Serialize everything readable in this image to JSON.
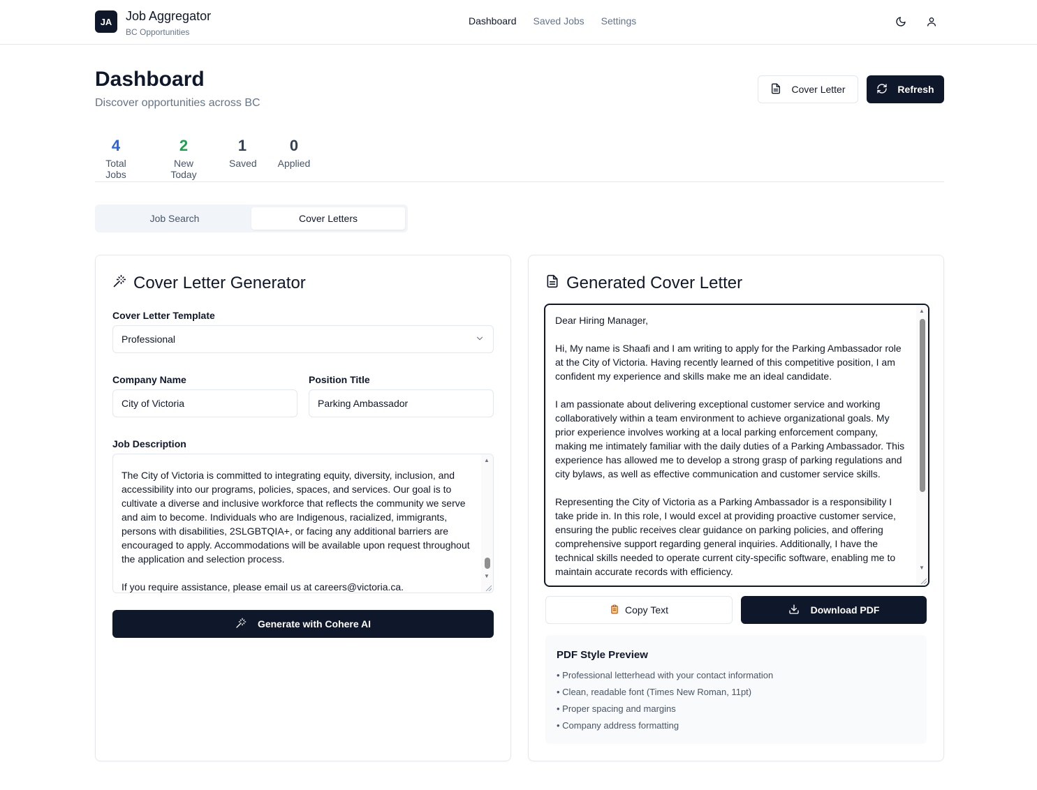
{
  "header": {
    "logo_text": "JA",
    "app_title": "Job Aggregator",
    "app_subtitle": "BC Opportunities",
    "nav": [
      {
        "label": "Dashboard",
        "active": true
      },
      {
        "label": "Saved Jobs",
        "active": false
      },
      {
        "label": "Settings",
        "active": false
      }
    ],
    "icons": [
      "moon-icon",
      "user-icon"
    ]
  },
  "page": {
    "title": "Dashboard",
    "subtitle": "Discover opportunities across BC",
    "cover_letter_button": "Cover Letter",
    "refresh_button": "Refresh"
  },
  "stats": [
    {
      "value": "4",
      "label": "Total Jobs",
      "color": "#2563eb"
    },
    {
      "value": "2",
      "label": "New Today",
      "color": "#16a34a"
    },
    {
      "value": "1",
      "label": "Saved",
      "color": "#334155"
    },
    {
      "value": "0",
      "label": "Applied",
      "color": "#334155"
    }
  ],
  "tabs": [
    {
      "label": "Job Search",
      "active": false
    },
    {
      "label": "Cover Letters",
      "active": true
    }
  ],
  "generator": {
    "title": "Cover Letter Generator",
    "template_label": "Cover Letter Template",
    "template_value": "Professional",
    "company_label": "Company Name",
    "company_value": "City of Victoria",
    "position_label": "Position Title",
    "position_value": "Parking Ambassador",
    "description_label": "Job Description",
    "description_value": "The City of Victoria is committed to integrating equity, diversity, inclusion, and accessibility into our programs, policies, spaces, and services. Our goal is to cultivate a diverse and inclusive workforce that reflects the community we serve and aim to become. Individuals who are Indigenous, racialized, immigrants, persons with disabilities, 2SLGBTQIA+, or facing any additional barriers are encouraged to apply. Accommodations will be available upon request throughout the application and selection process.\n\nIf you require assistance, please email us at careers@victoria.ca.",
    "generate_button": "Generate with Cohere AI"
  },
  "output": {
    "title": "Generated Cover Letter",
    "letter_text": "Dear Hiring Manager,\n\nHi, My name is Shaafi and I am writing to apply for the Parking Ambassador role at the City of Victoria. Having recently learned of this competitive position, I am confident my experience and skills make me an ideal candidate.\n\nI am passionate about delivering exceptional customer service and working collaboratively within a team environment to achieve organizational goals. My prior experience involves working at a local parking enforcement company, making me intimately familiar with the daily duties of a Parking Ambassador. This experience has allowed me to develop a strong grasp of parking regulations and city bylaws, as well as effective communication and customer service skills.\n\nRepresenting the City of Victoria as a Parking Ambassador is a responsibility I take pride in. In this role, I would excel at providing proactive customer service, ensuring the public receives clear guidance on parking policies, and offering comprehensive support regarding general inquiries. Additionally, I have the technical skills needed to operate current city-specific software, enabling me to maintain accurate records with efficiency.",
    "copy_button": "Copy Text",
    "download_button": "Download PDF",
    "preview_title": "PDF Style Preview",
    "preview_items": [
      "• Professional letterhead with your contact information",
      "• Clean, readable font (Times New Roman, 11pt)",
      "• Proper spacing and margins",
      "• Company address formatting"
    ]
  },
  "colors": {
    "primary": "#0f172a",
    "muted": "#64748b",
    "border": "#e2e8f0",
    "blue": "#2563eb",
    "green": "#16a34a"
  }
}
